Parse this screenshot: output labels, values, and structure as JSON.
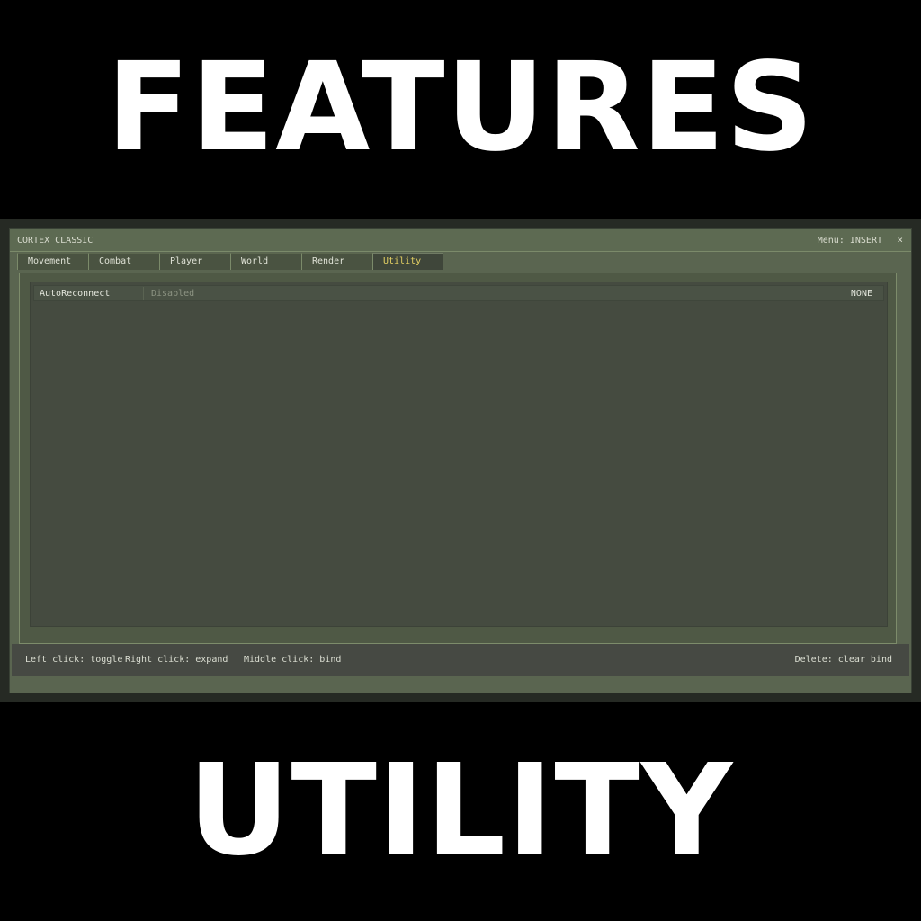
{
  "banner": {
    "top": "FEATURES",
    "bottom": "UTILITY"
  },
  "window": {
    "title": "CORTEX CLASSIC",
    "menu_key": "Menu: INSERT",
    "close_glyph": "×"
  },
  "tabs": [
    {
      "label": "Movement",
      "active": false
    },
    {
      "label": "Combat",
      "active": false
    },
    {
      "label": "Player",
      "active": false
    },
    {
      "label": "World",
      "active": false
    },
    {
      "label": "Render",
      "active": false
    },
    {
      "label": "Utility",
      "active": true
    }
  ],
  "modules": [
    {
      "name": "AutoReconnect",
      "status": "Disabled",
      "bind": "NONE"
    }
  ],
  "footer": {
    "left_click": "Left click: toggle",
    "right_click": "Right click: expand",
    "middle_click": "Middle click: bind",
    "delete": "Delete: clear bind"
  },
  "colors": {
    "active_tab_text": "#e3cf63",
    "window_bg": "#5a6550",
    "panel_bg": "#454b40"
  }
}
